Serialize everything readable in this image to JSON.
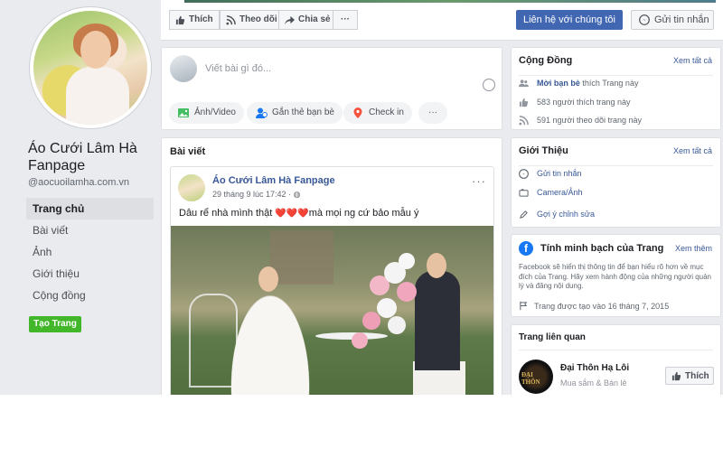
{
  "sidebar": {
    "page_name": "Áo Cưới Lâm Hà Fanpage",
    "handle": "@aocuoilamha.com.vn",
    "nav": [
      "Trang chủ",
      "Bài viết",
      "Ảnh",
      "Giới thiệu",
      "Cộng đồng"
    ],
    "create_page": "Tạo Trang"
  },
  "actions": {
    "like": "Thích",
    "follow": "Theo dõi",
    "share": "Chia sẻ",
    "more": "···",
    "contact": "Liên hệ với chúng tôi",
    "message": "Gửi tin nhắn"
  },
  "composer": {
    "placeholder": "Viết bài gì đó...",
    "photo_video": "Ảnh/Video",
    "tag_friends": "Gắn thẻ bạn bè",
    "check_in": "Check in",
    "more": "···"
  },
  "posts": {
    "title": "Bài viết",
    "items": [
      {
        "author": "Áo Cưới Lâm Hà Fanpage",
        "time": "29 tháng 9 lúc 17:42 · ",
        "text_before": "Dâu rể nhà mình thật ",
        "hearts": "❤️❤️❤️",
        "text_after": "mà mọi ng cứ bảo mẫu ý",
        "more": "···"
      }
    ]
  },
  "community": {
    "title": "Cộng Đồng",
    "see_all": "Xem tất cả",
    "invite_strong": "Mời bạn bè",
    "invite_rest": " thích Trang này",
    "likes": "583 người thích trang này",
    "follows": "591 người theo dõi trang này"
  },
  "about": {
    "title": "Giới Thiệu",
    "see_all": "Xem tất cả",
    "send_message": "Gửi tin nhắn",
    "camera": "Camera/Ảnh",
    "suggest_edit": "Gợi ý chỉnh sửa"
  },
  "transparency": {
    "title": "Tính minh bạch của Trang",
    "see_more": "Xem thêm",
    "description": "Facebook sẽ hiển thị thông tin để bạn hiểu rõ hơn về mục đích của Trang. Hãy xem hành động của những người quản lý và đăng nội dung.",
    "created": "Trang được tạo vào 16 tháng 7, 2015"
  },
  "related": {
    "title": "Trang liên quan",
    "items": [
      {
        "name": "Đại Thôn Hạ Lôi",
        "category": "Mua sắm & Bán lẻ",
        "like": "Thích",
        "logo_text": "ĐẠI THÔN"
      }
    ]
  },
  "colors": {
    "primary": "#4267b2",
    "link": "#385898",
    "create_green": "#42b72a",
    "background": "#e9ebee"
  }
}
